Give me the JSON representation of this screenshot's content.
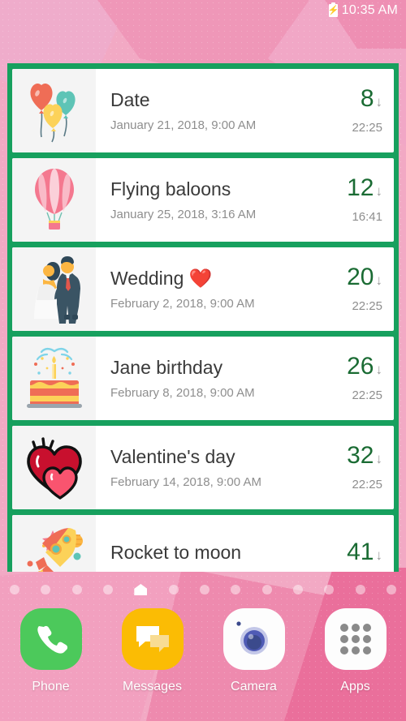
{
  "status_bar": {
    "battery_icon": "battery-charging-icon",
    "time": "10:35 AM"
  },
  "widget": {
    "accent_color": "#17a05e",
    "count_color": "#1a6b33",
    "arrow_glyph": "↓",
    "events": [
      {
        "icon": "heart-balloons-icon",
        "title": "Date",
        "datetime": "January 21, 2018, 9:00 AM",
        "count": "8",
        "arrow": "↓",
        "time": "22:25"
      },
      {
        "icon": "hot-air-balloon-icon",
        "title": "Flying baloons",
        "datetime": "January 25, 2018, 3:16 AM",
        "count": "12",
        "arrow": "↓",
        "time": "16:41"
      },
      {
        "icon": "wedding-couple-icon",
        "title": "Wedding ❤️",
        "datetime": "February 2, 2018, 9:00 AM",
        "count": "20",
        "arrow": "↓",
        "time": "22:25"
      },
      {
        "icon": "birthday-cake-icon",
        "title": "Jane birthday",
        "datetime": "February 8, 2018, 9:00 AM",
        "count": "26",
        "arrow": "↓",
        "time": "22:25"
      },
      {
        "icon": "two-hearts-icon",
        "title": "Valentine's day",
        "datetime": "February 14, 2018, 9:00 AM",
        "count": "32",
        "arrow": "↓",
        "time": "22:25"
      },
      {
        "icon": "rocket-icon",
        "title": "Rocket to moon",
        "datetime": "",
        "count": "41",
        "arrow": "↓",
        "time": ""
      }
    ]
  },
  "page_indicator": {
    "total_dots": 13,
    "home_index": 4,
    "home_icon": "home-icon"
  },
  "dock": {
    "apps": [
      {
        "icon": "phone-icon",
        "label": "Phone",
        "color": "#4cc95b"
      },
      {
        "icon": "messages-icon",
        "label": "Messages",
        "color": "#fbbc04"
      },
      {
        "icon": "camera-icon",
        "label": "Camera",
        "color": "#ffffff"
      },
      {
        "icon": "apps-grid-icon",
        "label": "Apps",
        "color": "#ffffff"
      }
    ]
  }
}
